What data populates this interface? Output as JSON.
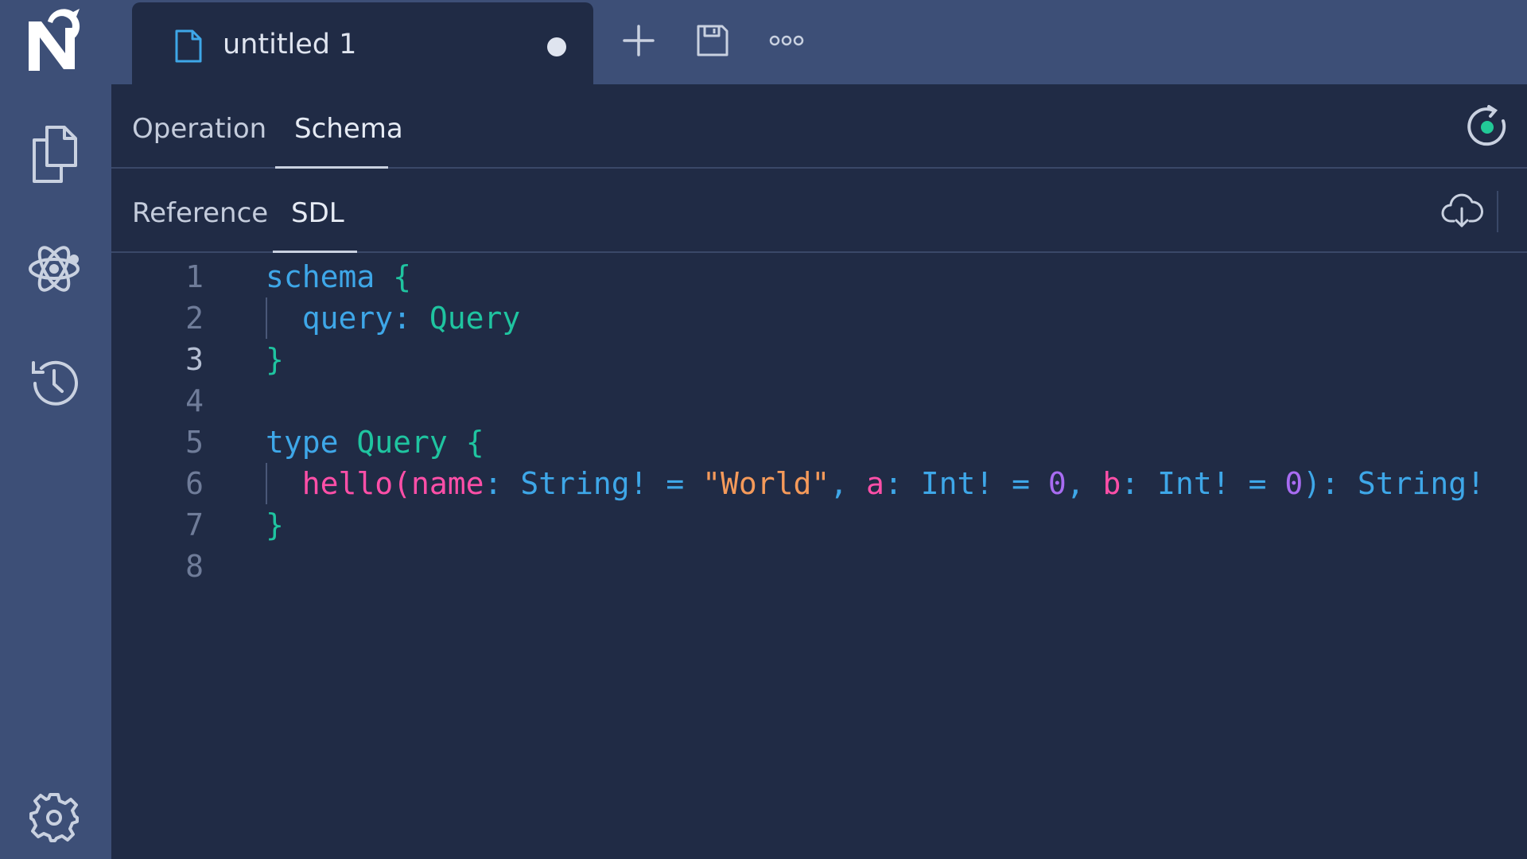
{
  "window": {
    "tab_title": "untitled 1"
  },
  "icons": {
    "sidebar": [
      "app-logo-icon",
      "documents-icon",
      "atom-icon",
      "history-icon",
      "settings-icon"
    ],
    "topbar": [
      "file-icon",
      "unsaved-dot-icon",
      "plus-icon",
      "save-icon",
      "more-icon"
    ],
    "content": [
      "refresh-icon",
      "cloud-download-icon"
    ]
  },
  "main_tabs": [
    {
      "label": "Operation",
      "active": false
    },
    {
      "label": "Schema",
      "active": true
    }
  ],
  "sub_tabs": [
    {
      "label": "Reference",
      "active": false
    },
    {
      "label": "SDL",
      "active": true
    }
  ],
  "editor": {
    "line_numbers": [
      "1",
      "2",
      "3",
      "4",
      "5",
      "6",
      "7",
      "8"
    ],
    "lines": [
      [
        {
          "t": "schema",
          "k": "kw"
        },
        {
          "t": " ",
          "k": "plain"
        },
        {
          "t": "{",
          "k": "punc"
        }
      ],
      [
        {
          "t": "  ",
          "k": "plain"
        },
        {
          "t": "query",
          "k": "field"
        },
        {
          "t": ": ",
          "k": "field"
        },
        {
          "t": "Query",
          "k": "type"
        }
      ],
      [
        {
          "t": "}",
          "k": "punc"
        }
      ],
      [],
      [
        {
          "t": "type",
          "k": "kw"
        },
        {
          "t": " ",
          "k": "plain"
        },
        {
          "t": "Query",
          "k": "type"
        },
        {
          "t": " ",
          "k": "plain"
        },
        {
          "t": "{",
          "k": "punc"
        }
      ],
      [
        {
          "t": "  ",
          "k": "plain"
        },
        {
          "t": "hello",
          "k": "fn"
        },
        {
          "t": "(",
          "k": "fn"
        },
        {
          "t": "name",
          "k": "arg"
        },
        {
          "t": ": ",
          "k": "plain"
        },
        {
          "t": "String!",
          "k": "plain"
        },
        {
          "t": " = ",
          "k": "plain"
        },
        {
          "t": "\"World\"",
          "k": "str"
        },
        {
          "t": ", ",
          "k": "plain"
        },
        {
          "t": "a",
          "k": "arg"
        },
        {
          "t": ": ",
          "k": "plain"
        },
        {
          "t": "Int!",
          "k": "plain"
        },
        {
          "t": " = ",
          "k": "plain"
        },
        {
          "t": "0",
          "k": "num"
        },
        {
          "t": ", ",
          "k": "plain"
        },
        {
          "t": "b",
          "k": "arg"
        },
        {
          "t": ": ",
          "k": "plain"
        },
        {
          "t": "Int!",
          "k": "plain"
        },
        {
          "t": " = ",
          "k": "plain"
        },
        {
          "t": "0",
          "k": "num"
        },
        {
          "t": "): ",
          "k": "plain"
        },
        {
          "t": "String!",
          "k": "plain"
        }
      ],
      [
        {
          "t": "}",
          "k": "punc"
        }
      ],
      []
    ]
  },
  "colors": {
    "sidebar_bg": "#3d4f77",
    "content_bg": "#202b45",
    "keyword": "#3ea7e8",
    "type": "#1fc4a0",
    "function": "#ff4fa8",
    "string": "#f59a5a",
    "number": "#a86cf2",
    "status_ok": "#22c997"
  }
}
